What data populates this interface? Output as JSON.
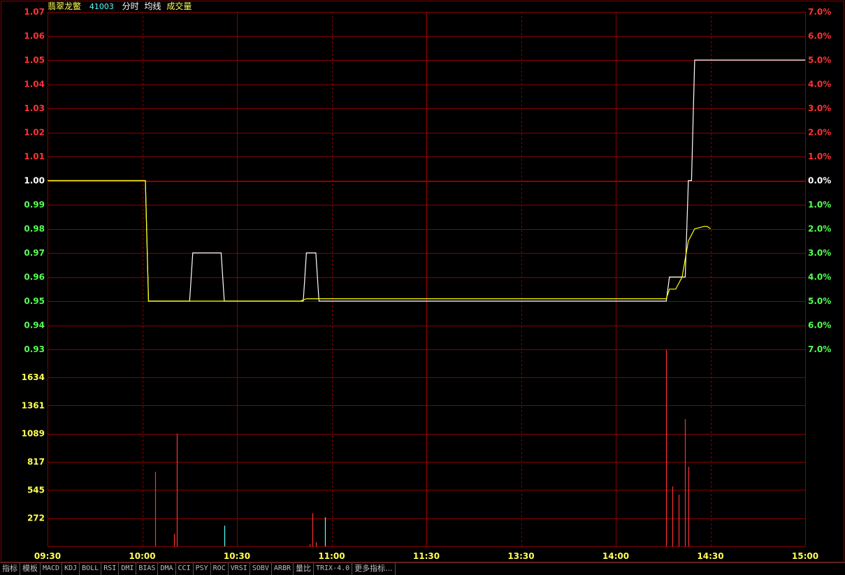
{
  "header": {
    "stock_name": "翡翠龙鳖",
    "stock_code": "41003",
    "indicators": [
      "分时",
      "均线",
      "成交量"
    ]
  },
  "colors": {
    "background": "#000000",
    "grid": "#8b0000",
    "price_line": "#ffffff",
    "avg_line": "#ffff00",
    "up": "#ff3232",
    "down": "#54ff54",
    "neutral": "#ffffff",
    "volume_label": "#ffff54",
    "time_label": "#ffff54"
  },
  "chart_data": {
    "type": "line",
    "x_labels": [
      "09:30",
      "10:00",
      "10:30",
      "11:00",
      "11:30",
      "13:30",
      "14:00",
      "14:30",
      "15:00"
    ],
    "price_axis": {
      "labels": [
        "1.07",
        "1.06",
        "1.05",
        "1.04",
        "1.03",
        "1.02",
        "1.01",
        "1.00",
        "0.99",
        "0.98",
        "0.97",
        "0.96",
        "0.95",
        "0.94",
        "0.93"
      ],
      "values": [
        1.07,
        1.06,
        1.05,
        1.04,
        1.03,
        1.02,
        1.01,
        1.0,
        0.99,
        0.98,
        0.97,
        0.96,
        0.95,
        0.94,
        0.93
      ],
      "reference": 1.0,
      "ylim": [
        0.93,
        1.07
      ]
    },
    "percent_axis": {
      "labels": [
        "7.0%",
        "6.0%",
        "5.0%",
        "4.0%",
        "3.0%",
        "2.0%",
        "1.0%",
        "0.0%",
        "1.0%",
        "2.0%",
        "3.0%",
        "4.0%",
        "5.0%",
        "6.0%",
        "7.0%"
      ]
    },
    "volume_axis": {
      "labels": [
        "1634",
        "1361",
        "1089",
        "817",
        "545",
        "272"
      ],
      "values": [
        1634,
        1361,
        1089,
        817,
        545,
        272
      ],
      "ylim": [
        0,
        1634
      ]
    },
    "series": [
      {
        "key": "price",
        "points": [
          [
            0,
            1.0
          ],
          [
            31,
            1.0
          ],
          [
            32,
            0.95
          ],
          [
            45,
            0.95
          ],
          [
            46,
            0.97
          ],
          [
            55,
            0.97
          ],
          [
            56,
            0.95
          ],
          [
            81,
            0.95
          ],
          [
            82,
            0.97
          ],
          [
            85,
            0.97
          ],
          [
            86,
            0.95
          ],
          [
            196,
            0.95
          ],
          [
            197,
            0.96
          ],
          [
            199,
            0.96
          ],
          [
            200,
            0.96
          ],
          [
            201,
            0.96
          ],
          [
            202,
            0.96
          ],
          [
            203,
            1.0
          ],
          [
            204,
            1.0
          ],
          [
            205,
            1.05
          ],
          [
            209,
            1.05
          ],
          [
            240,
            1.05
          ]
        ]
      },
      {
        "key": "avg",
        "points": [
          [
            0,
            1.0
          ],
          [
            31,
            1.0
          ],
          [
            32,
            0.95
          ],
          [
            80,
            0.95
          ],
          [
            82,
            0.951
          ],
          [
            196,
            0.951
          ],
          [
            197,
            0.955
          ],
          [
            199,
            0.955
          ],
          [
            201,
            0.96
          ],
          [
            203,
            0.975
          ],
          [
            205,
            0.98
          ],
          [
            208,
            0.981
          ],
          [
            209,
            0.981
          ],
          [
            210,
            0.98
          ]
        ]
      }
    ],
    "volume": [
      {
        "t": 34,
        "v": 720,
        "dir": "down"
      },
      {
        "t": 40,
        "v": 120,
        "dir": "down"
      },
      {
        "t": 41,
        "v": 1090,
        "dir": "down"
      },
      {
        "t": 56,
        "v": 200,
        "dir": "up"
      },
      {
        "t": 83,
        "v": 20,
        "dir": "down"
      },
      {
        "t": 84,
        "v": 320,
        "dir": "down"
      },
      {
        "t": 85,
        "v": 40,
        "dir": "down"
      },
      {
        "t": 88,
        "v": 280,
        "dir": "up"
      },
      {
        "t": 196,
        "v": 1900,
        "dir": "down"
      },
      {
        "t": 198,
        "v": 580,
        "dir": "down"
      },
      {
        "t": 200,
        "v": 500,
        "dir": "down"
      },
      {
        "t": 202,
        "v": 1230,
        "dir": "down"
      },
      {
        "t": 203,
        "v": 770,
        "dir": "down"
      }
    ]
  },
  "toolbar": {
    "tabs": [
      "指标",
      "模板",
      "MACD",
      "KDJ",
      "BOLL",
      "RSI",
      "DMI",
      "BIAS",
      "DMA",
      "CCI",
      "PSY",
      "ROC",
      "VRSI",
      "SOBV",
      "ARBR",
      "量比",
      "TRIX-4.0",
      "更多指标..."
    ]
  }
}
